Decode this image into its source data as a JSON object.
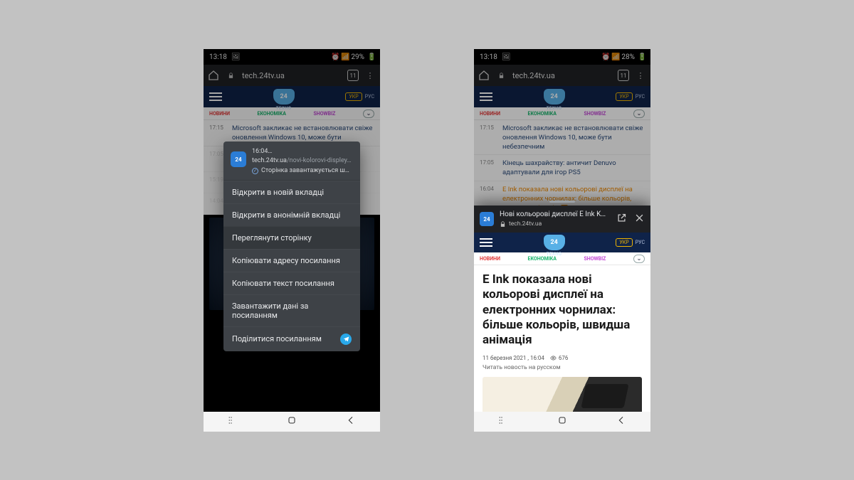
{
  "status": {
    "time": "13:18",
    "battery_left": "29%",
    "battery_right": "28%"
  },
  "browser": {
    "address": "tech.24tv.ua",
    "tabcount": "11"
  },
  "site": {
    "logo_sub": "ТЕХНО",
    "lang_ukr": "УКР",
    "lang_rus": "РУС"
  },
  "cats": {
    "novyny": "НОВИНИ",
    "ekonomika": "ЕКОНОМІКА",
    "showbiz": "SHOWBIZ"
  },
  "news": [
    {
      "time": "17:15",
      "text": "Microsoft закликає не встановлювати свіже оновлення Windows 10, може бути"
    },
    {
      "time": "17:05",
      "text": "Кінець шахрайству: античит Denuvo адаптували для ігор PS5"
    },
    {
      "time": "15:19",
      "text": ""
    },
    {
      "time": "14:04",
      "text": ""
    }
  ],
  "news_full": [
    {
      "time": "17:15",
      "text": "Microsoft закликає не встановлювати свіже оновлення Windows 10, може бути небезпечним"
    },
    {
      "time": "17:05",
      "text": "Кінець шахрайству: античит Denuvo адаптували для ігор PS5"
    },
    {
      "time": "16:04",
      "text": "E Ink показала нові кольорові дисплеї на електронних чорнилах: більше кольорів, швидша анімація",
      "highlight": true
    }
  ],
  "ctx": {
    "time": "16:04…",
    "domain": "tech.24tv.ua",
    "path": "/novi-kolorovi-displey…",
    "loading": "Сторінка завантажується ш…",
    "items": [
      "Відкрити в новій вкладці",
      "Відкрити в анонімній вкладці",
      "Переглянути сторінку",
      "Копіювати адресу посилання",
      "Копіювати текст посилання",
      "Завантажити дані за посиланням",
      "Поділитися посиланням"
    ]
  },
  "sheet": {
    "title": "Нові кольорові дисплеї E Ink K…",
    "site": "tech.24tv.ua"
  },
  "article": {
    "headline": "E Ink показала нові кольорові дисплеї на електронних чорнилах: більше кольорів, швидша анімація",
    "date": "11 березня 2021 ,   16:04",
    "views": "676",
    "readru": "Читать новость на русском"
  }
}
